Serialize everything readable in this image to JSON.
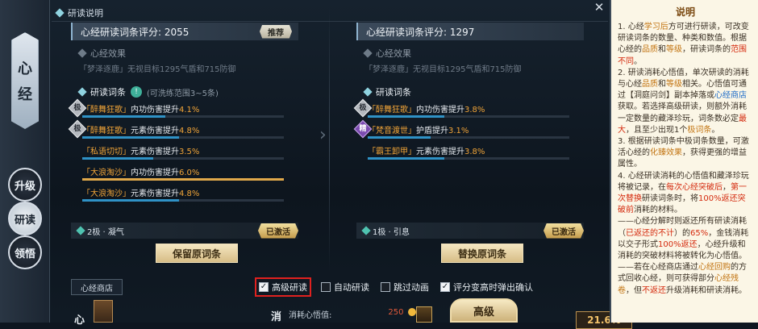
{
  "window": {
    "title": "研读说明",
    "close_icon": "close-icon"
  },
  "left_strip": {
    "plate": [
      "心",
      "经"
    ],
    "buttons": [
      {
        "label": "升级",
        "active": false
      },
      {
        "label": "研读",
        "active": true
      },
      {
        "label": "领悟",
        "active": false
      }
    ]
  },
  "left_panel": {
    "score_label": "心经研读词条评分: 2055",
    "recommend": "推荐",
    "effect_title": "心经效果",
    "effect_desc": "「梦泽逐鹿」无视目标1295气盾和715防御",
    "section_title": "研读词条",
    "section_hint": "(可洗练范围3~5条)",
    "entries": [
      {
        "grade": "极",
        "grade_color": "silver",
        "name": "「醉舞狂歌」",
        "desc": "内功伤害提升",
        "value": "4.1%",
        "fill": 0.41,
        "bar": "blue"
      },
      {
        "grade": "极",
        "grade_color": "silver",
        "name": "「醉舞狂歌」",
        "desc": "元素伤害提升",
        "value": "4.8%",
        "fill": 0.48,
        "bar": "blue"
      },
      {
        "grade": "",
        "grade_color": "none",
        "name": "「私语切切」",
        "desc": "元素伤害提升",
        "value": "3.5%",
        "fill": 0.35,
        "bar": "blue"
      },
      {
        "grade": "",
        "grade_color": "none",
        "name": "「大浪淘沙」",
        "desc": "内功伤害提升",
        "value": "6.0%",
        "fill": 1.0,
        "bar": "gold"
      },
      {
        "grade": "",
        "grade_color": "none",
        "name": "「大浪淘沙」",
        "desc": "元素伤害提升",
        "value": "4.8%",
        "fill": 0.48,
        "bar": "blue"
      }
    ],
    "level": "2极 · 凝气",
    "activated": "已激活",
    "button": "保留原词条"
  },
  "right_panel": {
    "score_label": "心经研读词条评分: 1297",
    "effect_title": "心经效果",
    "effect_desc": "「梦泽逐鹿」无视目标1295气盾和715防御",
    "section_title": "研读词条",
    "entries": [
      {
        "grade": "极",
        "grade_color": "silver",
        "name": "「醉舞狂歌」",
        "desc": "内功伤害提升",
        "value": "3.8%",
        "fill": 0.38,
        "bar": "blue"
      },
      {
        "grade": "精",
        "grade_color": "purple",
        "name": "「梵音渡世」",
        "desc": "护盾提升",
        "value": "3.1%",
        "fill": 0.31,
        "bar": "blue"
      },
      {
        "grade": "",
        "grade_color": "none",
        "name": "「霸王卸甲」",
        "desc": "元素伤害提升",
        "value": "3.8%",
        "fill": 0.38,
        "bar": "blue"
      }
    ],
    "level": "1极 · 引息",
    "activated": "已激活",
    "button": "替换原词条"
  },
  "bottom": {
    "shop_tab": "心经商店",
    "side_char": "心",
    "options": [
      {
        "label": "高级研读",
        "checked": true,
        "highlight": true
      },
      {
        "label": "自动研读",
        "checked": false,
        "highlight": false
      },
      {
        "label": "跳过动画",
        "checked": false,
        "highlight": false
      },
      {
        "label": "评分变高时弹出确认",
        "checked": true,
        "highlight": false
      }
    ],
    "xiao_char": "消",
    "cost_label": "消耗心悟值:",
    "cost_value": "250",
    "adv_button": "高级",
    "pct": "21.6%"
  },
  "explain": {
    "title": "说明"
  }
}
